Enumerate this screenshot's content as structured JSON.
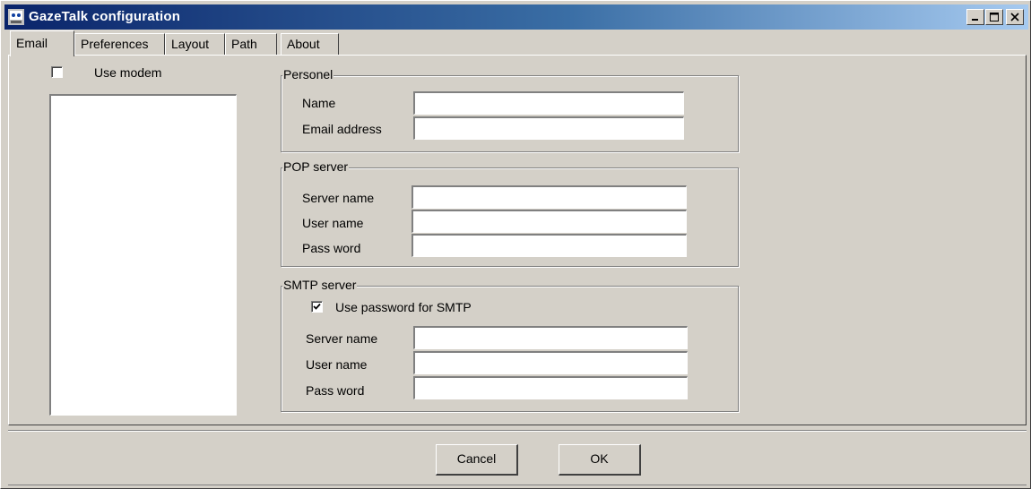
{
  "window": {
    "title": "GazeTalk configuration",
    "controls": [
      "minimize-icon",
      "maximize-icon",
      "close-icon"
    ]
  },
  "tabs": [
    {
      "label": "Email",
      "active": true
    },
    {
      "label": "Preferences",
      "active": false
    },
    {
      "label": "Layout",
      "active": false
    },
    {
      "label": "Path",
      "active": false
    },
    {
      "label": "About",
      "active": false
    }
  ],
  "email": {
    "use_modem": {
      "label": "Use modem",
      "checked": false
    },
    "personel": {
      "legend": "Personel",
      "name_label": "Name",
      "name_value": "",
      "email_label": "Email address",
      "email_value": ""
    },
    "pop": {
      "legend": "POP server",
      "server_label": "Server name",
      "server_value": "",
      "user_label": "User name",
      "user_value": "",
      "pass_label": "Pass word",
      "pass_value": ""
    },
    "smtp": {
      "legend": "SMTP server",
      "use_password_label": "Use password for SMTP",
      "use_password_checked": true,
      "server_label": "Server name",
      "server_value": "",
      "user_label": "User name",
      "user_value": "",
      "pass_label": "Pass word",
      "pass_value": ""
    }
  },
  "buttons": {
    "cancel": "Cancel",
    "ok": "OK"
  },
  "colors": {
    "face": "#d4d0c8",
    "title_start": "#0a246a",
    "title_end": "#a6caf0"
  }
}
